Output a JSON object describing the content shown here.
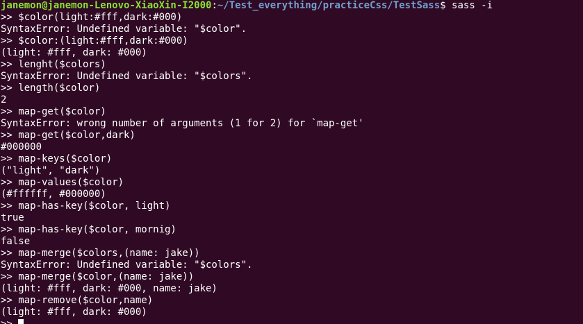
{
  "prompt": {
    "user_host": "janemon@janemon-Lenovo-XiaoXin-I2000",
    "separator": ":",
    "path": "~/Test_everything/practiceCss/TestSass",
    "symbol": "$ ",
    "command": "sass -i"
  },
  "lines": [
    ">> $color(light:#fff,dark:#000)",
    "SyntaxError: Undefined variable: \"$color\".",
    ">> $color:(light:#fff,dark:#000)",
    "(light: #fff, dark: #000)",
    ">> lenght($colors)",
    "SyntaxError: Undefined variable: \"$colors\".",
    ">> length($color)",
    "2",
    ">> map-get($color)",
    "SyntaxError: wrong number of arguments (1 for 2) for `map-get'",
    ">> map-get($color,dark)",
    "#000000",
    ">> map-keys($color)",
    "(\"light\", \"dark\")",
    ">> map-values($color)",
    "(#ffffff, #000000)",
    ">> map-has-key($color, light)",
    "true",
    ">> map-has-key($color, mornig)",
    "false",
    ">> map-merge($colors,(name: jake))",
    "SyntaxError: Undefined variable: \"$colors\".",
    ">> map-merge($color,(name: jake))",
    "(light: #fff, dark: #000, name: jake)",
    ">> map-remove($color,name)",
    "(light: #fff, dark: #000)"
  ],
  "input_prefix": ">> ",
  "colors": {
    "background": "#300a24",
    "text": "#ffffff",
    "user_host": "#8ae234",
    "path": "#729fcf"
  }
}
